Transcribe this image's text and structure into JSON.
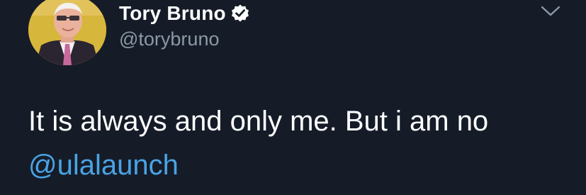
{
  "author": {
    "display_name": "Tory Bruno",
    "handle": "@torybruno",
    "verified": true,
    "avatar": "avatar"
  },
  "tweet": {
    "text": "It is always and only me. But i am no",
    "mention": "@ulalaunch"
  },
  "icons": {
    "verified": "verified-badge-icon",
    "menu": "chevron-down-icon"
  },
  "colors": {
    "background": "#151c28",
    "text": "#ffffff",
    "secondary_text": "#8b98a5",
    "link": "#4aa3e4"
  }
}
